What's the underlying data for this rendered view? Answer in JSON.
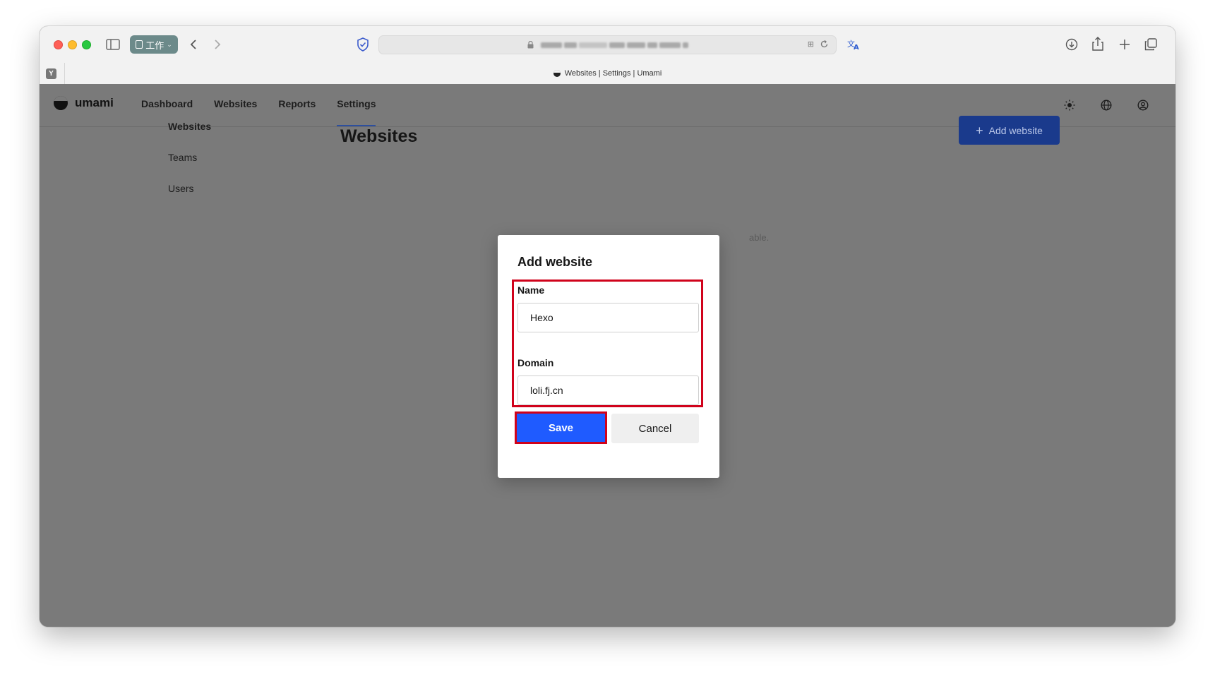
{
  "browser": {
    "tab_group_label": "工作",
    "tab_title": "Websites | Settings | Umami",
    "pinned_tab_letter": "Y"
  },
  "app": {
    "brand": "umami",
    "nav": [
      {
        "label": "Dashboard",
        "active": false
      },
      {
        "label": "Websites",
        "active": false
      },
      {
        "label": "Reports",
        "active": false
      },
      {
        "label": "Settings",
        "active": true
      }
    ],
    "sidebar": [
      {
        "label": "Websites",
        "active": true
      },
      {
        "label": "Teams",
        "active": false
      },
      {
        "label": "Users",
        "active": false
      }
    ],
    "page_title": "Websites",
    "add_button_label": "Add website",
    "background_note": "able."
  },
  "modal": {
    "title": "Add website",
    "name_label": "Name",
    "name_value": "Hexo",
    "domain_label": "Domain",
    "domain_value": "loli.fj.cn",
    "save_label": "Save",
    "cancel_label": "Cancel"
  },
  "colors": {
    "primary": "#1f5bff",
    "highlight": "#d0021b",
    "overlay": "#7a7a7a",
    "add_button": "#1a3a8c"
  }
}
